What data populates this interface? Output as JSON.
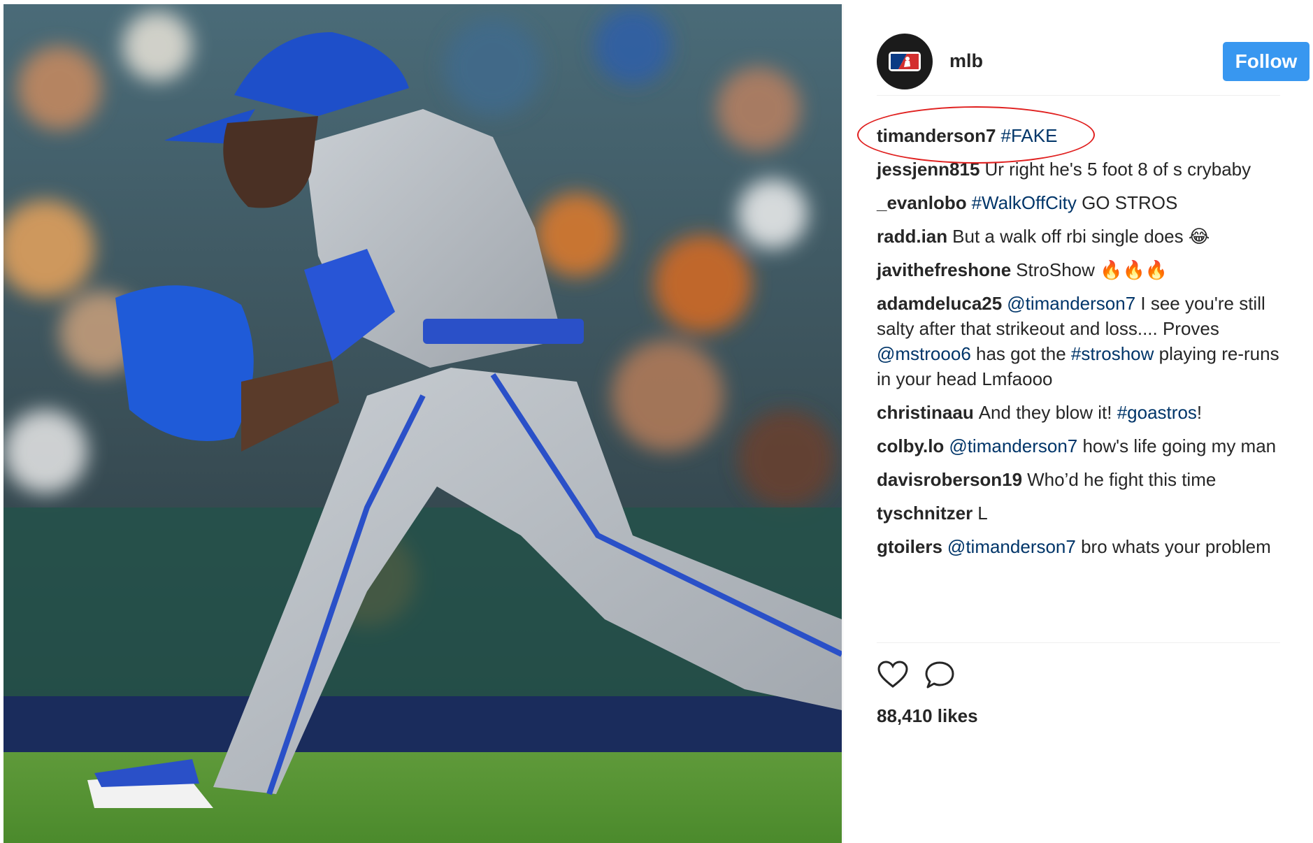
{
  "post": {
    "account": {
      "username": "mlb",
      "follow_label": "Follow"
    },
    "caption": {
      "author": "timanderson7",
      "text": "#FAKE",
      "annotation_color": "#e0201f"
    },
    "comments": [
      {
        "author": "jessjenn815",
        "parts": [
          {
            "t": "Ur right he's 5 foot 8 of s crybaby"
          }
        ]
      },
      {
        "author": "_evanlobo",
        "parts": [
          {
            "t": "#WalkOffCity",
            "tag": true
          },
          {
            "t": " GO STROS"
          }
        ]
      },
      {
        "author": "radd.ian",
        "parts": [
          {
            "t": "But a walk off rbi single does 😂"
          }
        ]
      },
      {
        "author": "javithefreshone",
        "parts": [
          {
            "t": "StroShow 🔥🔥🔥"
          }
        ]
      },
      {
        "author": "adamdeluca25",
        "parts": [
          {
            "t": "@timanderson7",
            "tag": true
          },
          {
            "t": " I see you're still salty after that strikeout and loss.... Proves "
          },
          {
            "t": "@mstrooo6",
            "tag": true
          },
          {
            "t": " has got the "
          },
          {
            "t": "#stroshow",
            "tag": true
          },
          {
            "t": " playing re-runs in your head Lmfaooo"
          }
        ]
      },
      {
        "author": "christinaau",
        "parts": [
          {
            "t": "And they blow it! "
          },
          {
            "t": "#goastros",
            "tag": true
          },
          {
            "t": "!"
          }
        ]
      },
      {
        "author": "colby.lo",
        "parts": [
          {
            "t": "@timanderson7",
            "tag": true
          },
          {
            "t": " how's life going my man"
          }
        ]
      },
      {
        "author": "davisroberson19",
        "parts": [
          {
            "t": "Who’d he fight this time"
          }
        ]
      },
      {
        "author": "tyschnitzer",
        "parts": [
          {
            "t": "L"
          }
        ]
      },
      {
        "author": "gtoilers",
        "parts": [
          {
            "t": "@timanderson7",
            "tag": true
          },
          {
            "t": " bro whats your problem"
          }
        ]
      }
    ],
    "actions": {
      "like_icon": "heart-icon",
      "comment_icon": "comment-bubble-icon"
    },
    "likes": "88,410 likes",
    "colors": {
      "follow_button": "#3897f0",
      "hashtag": "#003569"
    }
  }
}
